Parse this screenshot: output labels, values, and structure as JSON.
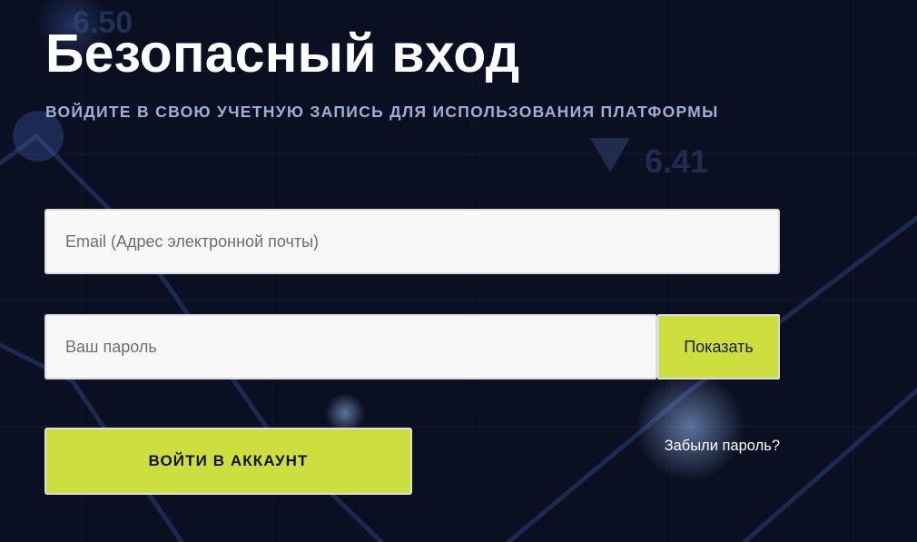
{
  "login": {
    "title": "Безопасный вход",
    "subtitle": "ВОЙДИТЕ В СВОЮ УЧЕТНУЮ ЗАПИСЬ ДЛЯ ИСПОЛЬЗОВАНИЯ ПЛАТФОРМЫ",
    "email": {
      "value": "",
      "placeholder": "Email (Адрес электронной почты)"
    },
    "password": {
      "value": "",
      "placeholder": "Ваш пароль"
    },
    "show_password_label": "Показать",
    "submit_label": "ВОЙТИ В АККАУНТ",
    "forgot_password_label": "Забыли пароль?"
  },
  "background": {
    "ticker_top": "6.50",
    "ticker_mid": "6.41",
    "bearish_arrow_icon": "triangle-down-icon"
  },
  "colors": {
    "background": "#0b0f22",
    "accent": "#cddf3e",
    "subtitle": "#9fb0d6",
    "field_background": "#f8f8f8"
  }
}
